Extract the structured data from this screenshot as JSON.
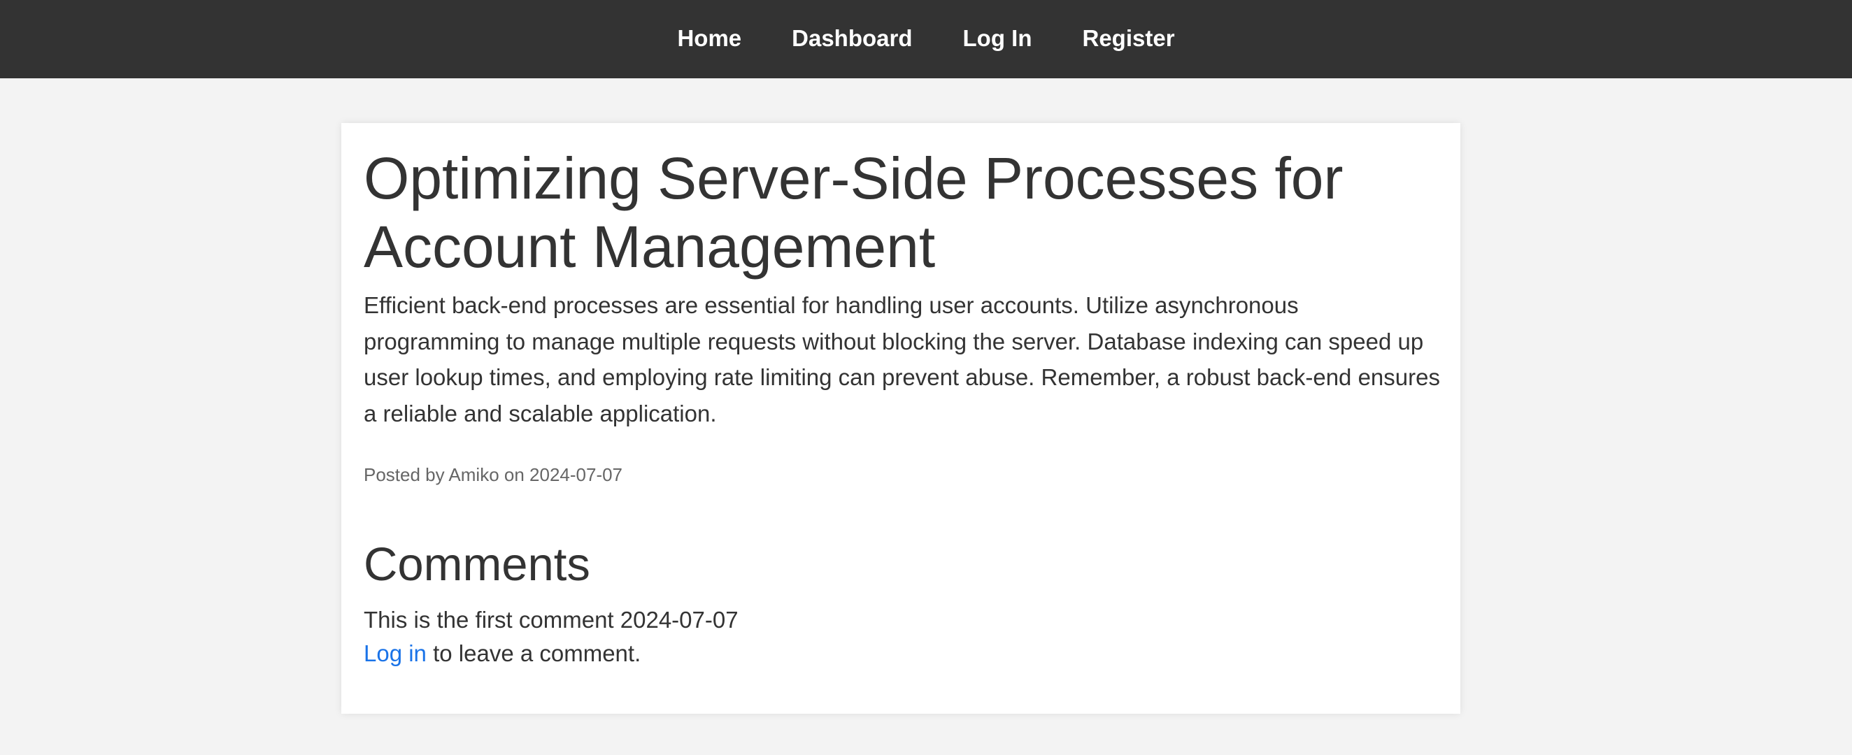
{
  "nav": {
    "items": [
      {
        "label": "Home"
      },
      {
        "label": "Dashboard"
      },
      {
        "label": "Log In"
      },
      {
        "label": "Register"
      }
    ]
  },
  "post": {
    "title": "Optimizing Server-Side Processes for Account Management",
    "body": "Efficient back-end processes are essential for handling user accounts. Utilize asynchronous programming to manage multiple requests without blocking the server. Database indexing can speed up user lookup times, and employing rate limiting can prevent abuse. Remember, a robust back-end ensures a reliable and scalable application.",
    "meta": "Posted by Amiko on 2024-07-07"
  },
  "comments": {
    "heading": "Comments",
    "items": [
      {
        "text": "This is the first comment 2024-07-07"
      }
    ],
    "login_link": "Log in",
    "login_suffix": " to leave a comment."
  },
  "colors": {
    "navbar_bg": "#333333",
    "page_bg": "#f3f3f3",
    "link": "#1a73e8",
    "meta_text": "#666666"
  }
}
